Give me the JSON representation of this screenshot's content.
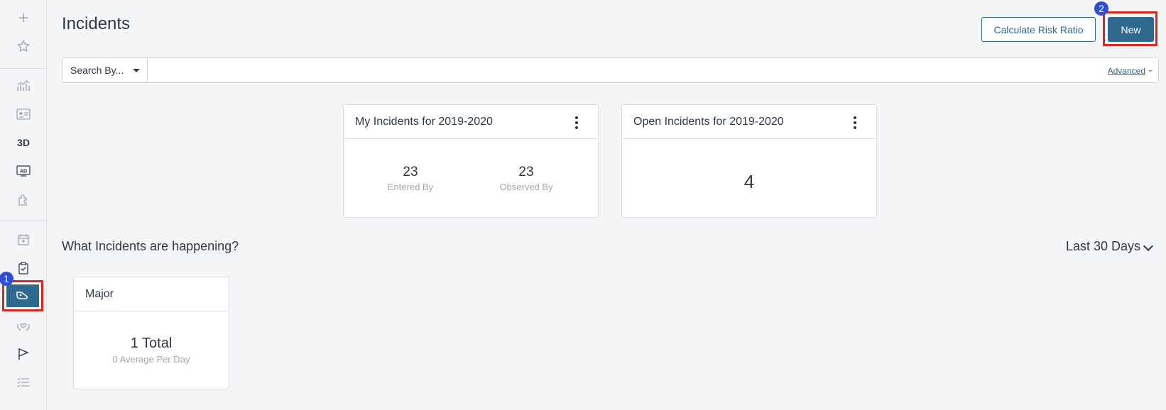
{
  "sidebar": {
    "icons": [
      {
        "name": "plus-icon",
        "glyph": "+"
      },
      {
        "name": "star-icon",
        "glyph": "☆"
      },
      {
        "name": "chart-icon",
        "glyph": "📈"
      },
      {
        "name": "id-card-icon",
        "glyph": "▤"
      },
      {
        "name": "3d-icon",
        "glyph": "3D"
      },
      {
        "name": "ad-icon",
        "glyph": "AD"
      },
      {
        "name": "puzzle-icon",
        "glyph": "✣"
      },
      {
        "name": "calendar-icon",
        "glyph": "▦"
      },
      {
        "name": "clipboard-icon",
        "glyph": "▣"
      },
      {
        "name": "incidents-icon",
        "glyph": "⊃"
      },
      {
        "name": "hands-heart-icon",
        "glyph": "♡"
      },
      {
        "name": "flag-icon",
        "glyph": "⚑"
      },
      {
        "name": "list-icon",
        "glyph": "☰"
      }
    ],
    "badge": "1"
  },
  "header": {
    "title": "Incidents",
    "calc_button": "Calculate Risk Ratio",
    "new_button": "New",
    "badge": "2"
  },
  "search": {
    "by_label": "Search By...",
    "placeholder": "",
    "advanced_label": "Advanced"
  },
  "cards": {
    "my": {
      "title": "My Incidents for 2019-2020",
      "entered_value": "23",
      "entered_label": "Entered By",
      "observed_value": "23",
      "observed_label": "Observed By"
    },
    "open": {
      "title": "Open Incidents for 2019-2020",
      "value": "4"
    }
  },
  "section": {
    "title": "What Incidents are happening?",
    "range": "Last 30 Days"
  },
  "major": {
    "title": "Major",
    "total": "1 Total",
    "avg": "0 Average Per Day"
  },
  "colors": {
    "accent": "#2f6a8e",
    "highlight": "#d62a1f",
    "badge": "#2e4ed8"
  }
}
